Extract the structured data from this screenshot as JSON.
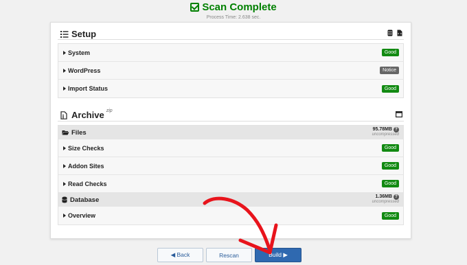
{
  "header": {
    "title": "Scan Complete",
    "process_time": "Process Time: 2.638 sec."
  },
  "setup": {
    "title": "Setup",
    "rows": [
      {
        "label": "System",
        "badge": "Good",
        "status": "good"
      },
      {
        "label": "WordPress",
        "badge": "Notice",
        "status": "notice"
      },
      {
        "label": "Import Status",
        "badge": "Good",
        "status": "good"
      }
    ]
  },
  "archive": {
    "title": "Archive",
    "sup": "zip",
    "files": {
      "label": "Files",
      "size": "95.78MB",
      "size_note": "uncompressed",
      "rows": [
        {
          "label": "Size Checks",
          "badge": "Good"
        },
        {
          "label": "Addon Sites",
          "badge": "Good"
        },
        {
          "label": "Read Checks",
          "badge": "Good"
        }
      ]
    },
    "database": {
      "label": "Database",
      "size": "1.36MB",
      "size_note": "uncompressed",
      "rows": [
        {
          "label": "Overview",
          "badge": "Good"
        }
      ]
    }
  },
  "buttons": {
    "back": "◀ Back",
    "rescan": "Rescan",
    "build": "Build ▶"
  },
  "colors": {
    "good": "#128a12",
    "notice": "#666666",
    "title_green": "#008000",
    "build_blue": "#2f69b0",
    "arrow_red": "#e8141c"
  }
}
